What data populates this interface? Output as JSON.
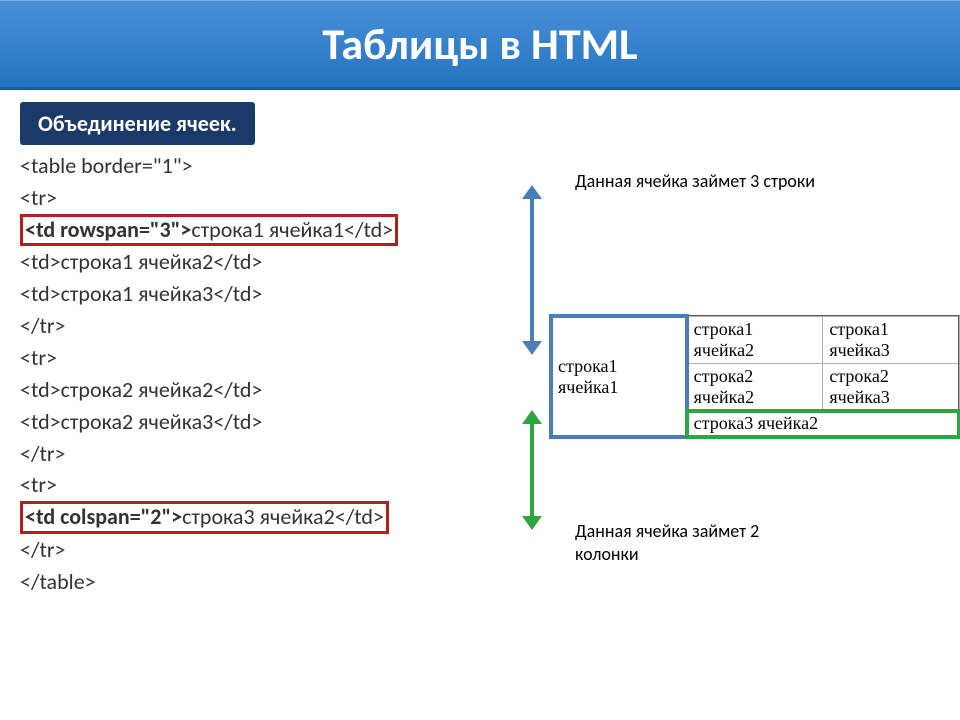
{
  "title": "Таблицы в HTML",
  "subtitle": "Объединение ячеек.",
  "code": {
    "l1": "<table border=\"1\">",
    "l2": "<tr>",
    "l3a": "<td rowspan=\"3\">",
    "l3b": "строка1 ячейка1</td>",
    "l4": "<td>строка1 ячейка2</td>",
    "l5": "<td>строка1 ячейка3</td>",
    "l6": "</tr>",
    "l7": "<tr>",
    "l8": "<td>строка2 ячейка2</td>",
    "l9": "<td>строка2 ячейка3</td>",
    "l10": "</tr>",
    "l11": "<tr>",
    "l12a": "<td colspan=\"2\">",
    "l12b": "строка3 ячейка2</td>",
    "l13": "</tr>",
    "l14": "</table>"
  },
  "annotations": {
    "top": "Данная ячейка займет 3 строки",
    "bottom": "Данная ячейка займет 2 колонки"
  },
  "table": {
    "r1c1": "строка1 ячейка1",
    "r1c2": "строка1 ячейка2",
    "r1c3": "строка1 ячейка3",
    "r2c2": "строка2 ячейка2",
    "r2c3": "строка2 ячейка3",
    "r3c2": "строка3 ячейка2"
  }
}
